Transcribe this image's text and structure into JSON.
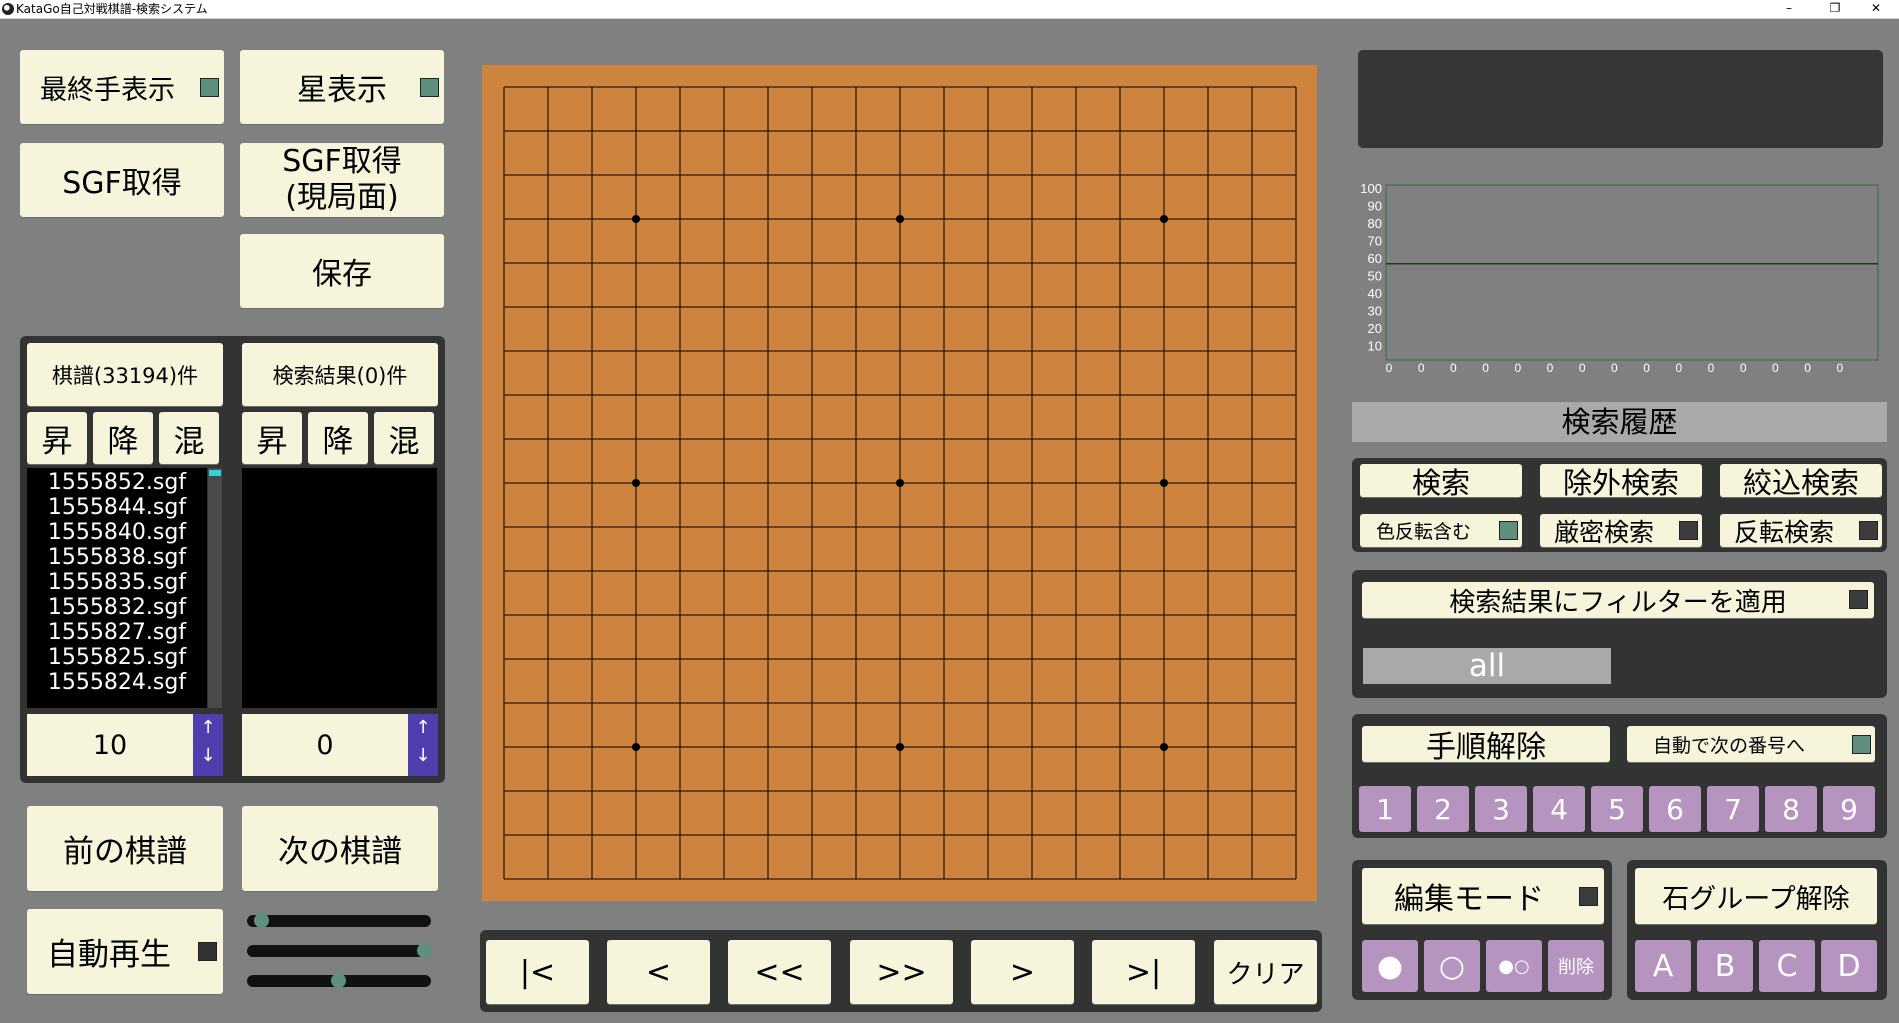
{
  "window": {
    "title": "KataGo自己対戦棋譜-検索システム",
    "controls": {
      "minimize": "–",
      "restore": "❐",
      "close": "✕"
    }
  },
  "left": {
    "last_move_button": "最終手表示",
    "star_button": "星表示",
    "sgf_get_button": "SGF取得",
    "sgf_get_current_line1": "SGF取得",
    "sgf_get_current_line2": "(現局面)",
    "save_button": "保存",
    "kifu_header": "棋譜(33194)件",
    "search_header": "検索結果(0)件",
    "sort_asc": "昇",
    "sort_desc": "降",
    "sort_mix": "混",
    "kifu_files": [
      "1555852.sgf",
      "1555844.sgf",
      "1555840.sgf",
      "1555838.sgf",
      "1555835.sgf",
      "1555832.sgf",
      "1555827.sgf",
      "1555825.sgf",
      "1555824.sgf"
    ],
    "kifu_count_value": "10",
    "search_count_value": "0",
    "arrow_up": "↑",
    "arrow_down": "↓",
    "prev_kifu_button": "前の棋譜",
    "next_kifu_button": "次の棋譜",
    "autoplay_button": "自動再生",
    "sliders": [
      0.08,
      0.97,
      0.5
    ]
  },
  "board": {
    "size": 19,
    "hoshi": [
      [
        3,
        3
      ],
      [
        3,
        9
      ],
      [
        3,
        15
      ],
      [
        9,
        3
      ],
      [
        9,
        9
      ],
      [
        9,
        15
      ],
      [
        15,
        3
      ],
      [
        15,
        9
      ],
      [
        15,
        15
      ]
    ],
    "colors": {
      "wood": "#ce833f",
      "line": "#000000"
    }
  },
  "nav": {
    "first": "|<",
    "prev": "<",
    "prev_many": "<<",
    "next_many": ">>",
    "next": ">",
    "last": ">|",
    "clear": "クリア"
  },
  "graph": {
    "y_ticks": [
      "100",
      "90",
      "80",
      "70",
      "60",
      "50",
      "40",
      "30",
      "20",
      "10"
    ],
    "x_ticks": [
      "0",
      "0",
      "0",
      "0",
      "0",
      "0",
      "0",
      "0",
      "0",
      "0",
      "0",
      "0",
      "0",
      "0",
      "0"
    ],
    "line_value": 55
  },
  "right": {
    "history_title": "検索履歴",
    "search_button": "検索",
    "exclude_search_button": "除外検索",
    "narrow_search_button": "絞込検索",
    "include_color_reverse": "色反転含む",
    "strict_search": "厳密検索",
    "reverse_search": "反転検索",
    "filter_apply": "検索結果にフィルターを適用",
    "filter_value": "all",
    "move_order_clear": "手順解除",
    "auto_next_number": "自動で次の番号へ",
    "numbers": [
      "1",
      "2",
      "3",
      "4",
      "5",
      "6",
      "7",
      "8",
      "9"
    ],
    "edit_mode": "編集モード",
    "stone_group_clear": "石グループ解除",
    "stone_black": "●",
    "stone_white": "○",
    "stone_alternate": "●○",
    "stone_delete": "削除",
    "groups": [
      "A",
      "B",
      "C",
      "D"
    ]
  }
}
